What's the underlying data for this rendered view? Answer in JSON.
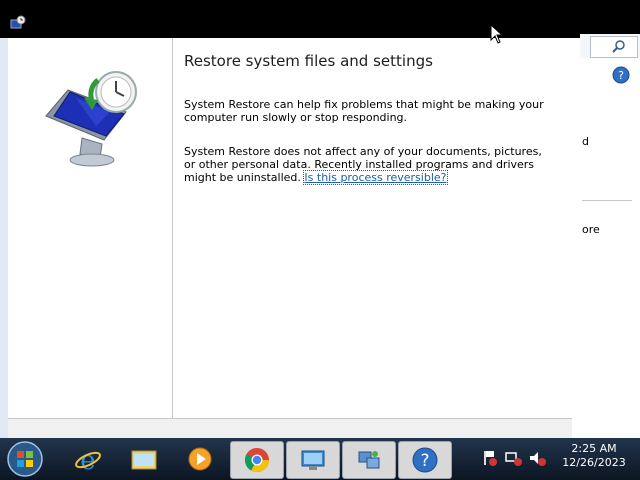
{
  "wizard": {
    "heading": "Restore system files and settings",
    "paragraph1": "System Restore can help fix problems that might be making your computer run slowly or stop responding.",
    "paragraph2_text": "System Restore does not affect any of your documents, pictures, or other personal data. Recently installed programs and drivers might be uninstalled.",
    "help_link": "Is this process reversible?"
  },
  "background_window": {
    "fragment1": "d",
    "fragment2": "ore"
  },
  "taskbar": {
    "buttons": [
      {
        "name": "internet-explorer-icon",
        "active": false
      },
      {
        "name": "file-explorer-icon",
        "active": false
      },
      {
        "name": "media-player-icon",
        "active": false
      },
      {
        "name": "chrome-icon",
        "active": true
      },
      {
        "name": "remote-desktop-icon",
        "active": true
      },
      {
        "name": "network-icon",
        "active": true
      },
      {
        "name": "help-icon",
        "active": true
      }
    ],
    "clock_time": "2:25 AM",
    "clock_date": "12/26/2023"
  },
  "colors": {
    "link": "#1b5fa8",
    "taskbar": "#0c1522",
    "window_bg": "#ffffff"
  }
}
